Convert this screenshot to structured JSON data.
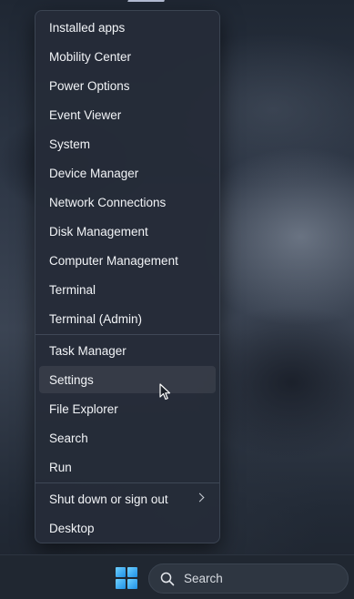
{
  "menu": {
    "items": [
      {
        "label": "Installed apps"
      },
      {
        "label": "Mobility Center"
      },
      {
        "label": "Power Options"
      },
      {
        "label": "Event Viewer"
      },
      {
        "label": "System"
      },
      {
        "label": "Device Manager"
      },
      {
        "label": "Network Connections"
      },
      {
        "label": "Disk Management"
      },
      {
        "label": "Computer Management"
      },
      {
        "label": "Terminal"
      },
      {
        "label": "Terminal (Admin)"
      },
      {
        "label": "Task Manager"
      },
      {
        "label": "Settings"
      },
      {
        "label": "File Explorer"
      },
      {
        "label": "Search"
      },
      {
        "label": "Run"
      },
      {
        "label": "Shut down or sign out"
      },
      {
        "label": "Desktop"
      }
    ]
  },
  "taskbar": {
    "search_label": "Search",
    "start_icon": "windows-logo-icon",
    "search_icon": "search-icon"
  },
  "colors": {
    "accent": "#1e90e6",
    "menu_bg": "#252c38",
    "taskbar_bg": "#202731"
  }
}
